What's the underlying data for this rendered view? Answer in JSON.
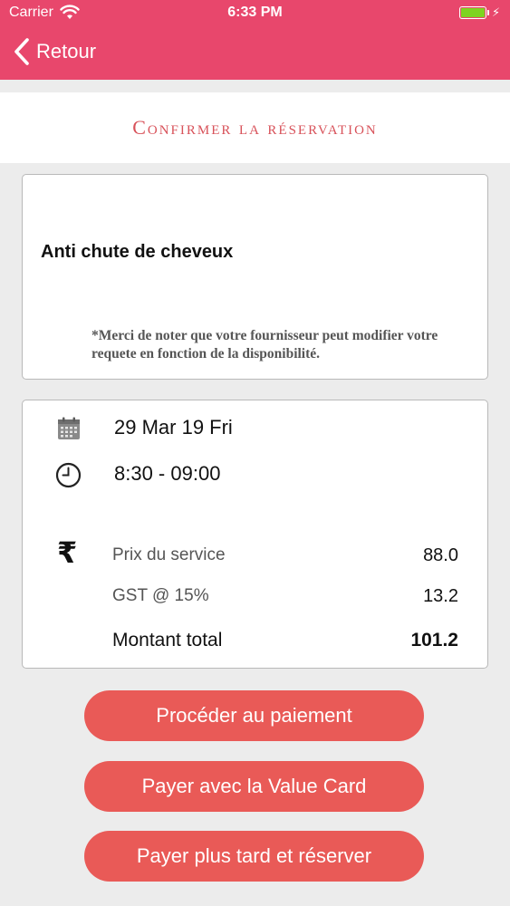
{
  "status_bar": {
    "carrier": "Carrier",
    "time": "6:33 PM",
    "battery_color": "#7ed321"
  },
  "nav": {
    "back_label": "Retour",
    "back_icon": "chevron-left-icon",
    "bar_color": "#e8476c"
  },
  "page": {
    "title": "Confirmer la réservation",
    "title_color": "#d8525a"
  },
  "service": {
    "name": "Anti chute de cheveux",
    "note": "*Merci de noter que votre fournisseur peut modifier votre requete en fonction de la disponibilité."
  },
  "booking": {
    "date": "29 Mar 19 Fri",
    "time": "8:30 - 09:00",
    "date_icon": "calendar-icon",
    "time_icon": "clock-icon",
    "currency_icon": "rupee-icon",
    "currency_symbol": "₹"
  },
  "pricing": {
    "service_label": "Prix du service",
    "service_value": "88.0",
    "tax_label": "GST @ 15%",
    "tax_value": "13.2",
    "total_label": "Montant total",
    "total_value": "101.2"
  },
  "actions": {
    "pay_now": "Procéder au paiement",
    "pay_value_card": "Payer avec la Value Card",
    "pay_later": "Payer plus tard et réserver",
    "button_color": "#e95a57"
  }
}
